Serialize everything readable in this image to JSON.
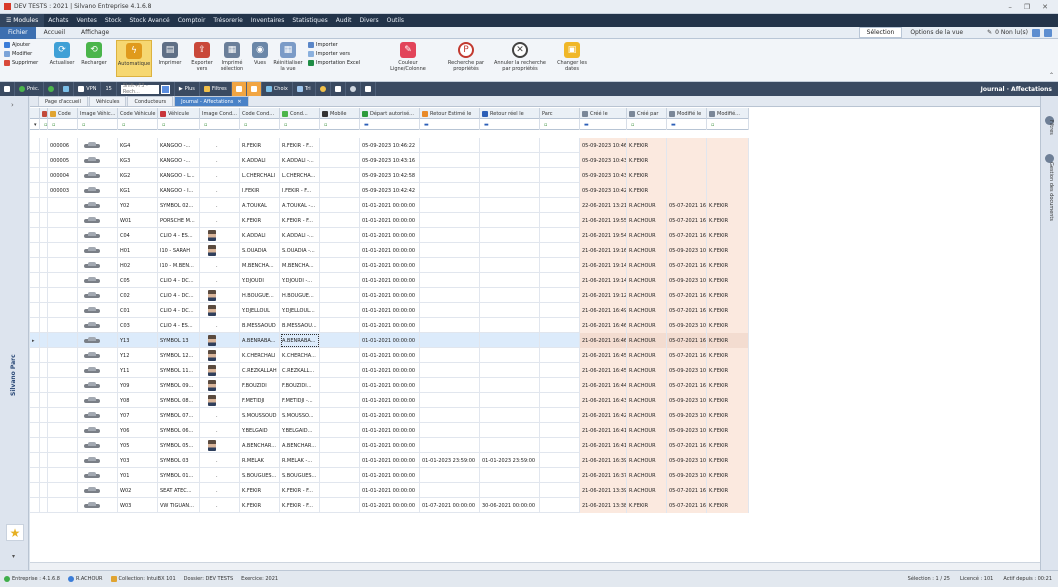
{
  "window": {
    "title": "DEV TESTS : 2021 | Silvano Entreprise 4.1.6.8",
    "controls": [
      "–",
      "❐",
      "✕"
    ]
  },
  "menu": {
    "modules": "Modules",
    "items": [
      "Achats",
      "Ventes",
      "Stock",
      "Stock Avancé",
      "Comptoir",
      "Trésorerie",
      "Inventaires",
      "Statistiques",
      "Audit",
      "Divers",
      "Outils"
    ]
  },
  "tabs": {
    "items": [
      "Fichier",
      "Accueil",
      "Affichage"
    ],
    "active": 0,
    "selection": "Sélection",
    "options": "Options de la vue",
    "nonlus": "0 Non lu(s)"
  },
  "ribbon": {
    "ajouter": "Ajouter",
    "modifier": "Modifier",
    "supprimer": "Supprimer",
    "actualiser": "Actualiser",
    "recharger": "Recharger",
    "automatique": "Automatique",
    "imprimer": "Imprimer",
    "exporter": "Exporter vers",
    "imprimer_sel": "Imprimé sélection",
    "vues": "Vues",
    "reinit": "Réinitialiser la vue",
    "importer": "Importer",
    "importer_vers": "Importer vers",
    "import_excel": "Importation Excel",
    "couleur": "Couleur Ligne/Colonne",
    "recherche_prop": "Recherche par propriétés",
    "annuler_rech": "Annuler la recherche par propriétés",
    "changer_dates": "Changer les dates"
  },
  "toolbar": {
    "prec": "Préc.",
    "vpn": "VPN",
    "count": "15",
    "search_placeholder": "Shift+F3 - Rech...",
    "plus": "Plus",
    "filtres": "Filtres",
    "choix": "Choix",
    "tri": "Tri",
    "breadcrumb": "Journal · Affectations"
  },
  "leftpanel": {
    "title": "Silvano Parc"
  },
  "rightpanel": {
    "filtres": "Filtres",
    "gestion": "Gestion des documents"
  },
  "doctabs": [
    {
      "label": "Page d'accueil"
    },
    {
      "label": "Véhicules"
    },
    {
      "label": "Conducteurs"
    },
    {
      "label": "Journal - Affectations",
      "active": true
    }
  ],
  "columns": [
    "Code",
    "Image Véhic...",
    "Code Véhicule",
    "Véhicule",
    "Image Cond...",
    "Code Cond...",
    "Cond...",
    "Mobile",
    "Départ autorisé...",
    "Retour Estimé le",
    "Retour réel le",
    "Parc",
    "Créé le",
    "Créé par",
    "Modifié le",
    "Modifié..."
  ],
  "rows": [
    {
      "code": "000006",
      "cv": "KG4",
      "veh": "KANGOO -...",
      "face": false,
      "cc": "R.FEKIR",
      "cond": "R.FEKIR - F...",
      "dep": "05-09-2023 10:46:22",
      "re": "",
      "rr": "",
      "cree": "05-09-2023 10:46:37",
      "cpar": "K.FEKIR",
      "mod": "",
      "mpar": ""
    },
    {
      "code": "000005",
      "cv": "KG3",
      "veh": "KANGOO -...",
      "face": false,
      "cc": "K.ADDALI",
      "cond": "K.ADDALI -...",
      "dep": "05-09-2023 10:43:16",
      "re": "",
      "rr": "",
      "cree": "05-09-2023 10:43:28",
      "cpar": "K.FEKIR",
      "mod": "",
      "mpar": ""
    },
    {
      "code": "000004",
      "cv": "KG2",
      "veh": "KANGOO - L...",
      "face": false,
      "cc": "L.CHERCHALI",
      "cond": "L.CHERCHA...",
      "dep": "05-09-2023 10:42:58",
      "re": "",
      "rr": "",
      "cree": "05-09-2023 10:43:10",
      "cpar": "K.FEKIR",
      "mod": "",
      "mpar": ""
    },
    {
      "code": "000003",
      "cv": "KG1",
      "veh": "KANGOO - I...",
      "face": false,
      "cc": "I.FEKIR",
      "cond": "I.FEKIR - F...",
      "dep": "05-09-2023 10:42:42",
      "re": "",
      "rr": "",
      "cree": "05-09-2023 10:42:53",
      "cpar": "K.FEKIR",
      "mod": "",
      "mpar": ""
    },
    {
      "code": "",
      "cv": "Y02",
      "veh": "SYMBOL 02...",
      "face": false,
      "cc": "A.TOUKAL",
      "cond": "A.TOUKAL -...",
      "dep": "01-01-2021 00:00:00",
      "re": "",
      "rr": "",
      "cree": "22-06-2021 13:21:27",
      "cpar": "R.ACHOUR",
      "mod": "05-07-2021 16:01:42",
      "mpar": "K.FEKIR"
    },
    {
      "code": "",
      "cv": "W01",
      "veh": "PORSCHE M...",
      "face": false,
      "cc": "K.FEKIR",
      "cond": "K.FEKIR - F...",
      "dep": "01-01-2021 00:00:00",
      "re": "",
      "rr": "",
      "cree": "21-06-2021 19:55:25",
      "cpar": "R.ACHOUR",
      "mod": "05-07-2021 16:01:42",
      "mpar": "K.FEKIR"
    },
    {
      "code": "",
      "cv": "C04",
      "veh": "CLIO 4 - ES...",
      "face": true,
      "cc": "K.ADDALI",
      "cond": "K.ADDALI -...",
      "dep": "01-01-2021 00:00:00",
      "re": "",
      "rr": "",
      "cree": "21-06-2021 19:54:40",
      "cpar": "R.ACHOUR",
      "mod": "05-07-2021 16:01:42",
      "mpar": "K.FEKIR"
    },
    {
      "code": "",
      "cv": "H01",
      "veh": "I10 - SARAH",
      "face": true,
      "cc": "S.OUADIA",
      "cond": "S.OUADIA -...",
      "dep": "01-01-2021 00:00:00",
      "re": "",
      "rr": "",
      "cree": "21-06-2021 19:16:25",
      "cpar": "R.ACHOUR",
      "mod": "05-09-2023 10:37:22",
      "mpar": "K.FEKIR"
    },
    {
      "code": "",
      "cv": "H02",
      "veh": "I10 - M.BEN...",
      "face": false,
      "cc": "M.BENCHA...",
      "cond": "M.BENCHA...",
      "dep": "01-01-2021 00:00:00",
      "re": "",
      "rr": "",
      "cree": "21-06-2021 19:14:53",
      "cpar": "R.ACHOUR",
      "mod": "05-07-2021 16:01:42",
      "mpar": "K.FEKIR"
    },
    {
      "code": "",
      "cv": "C05",
      "veh": "CLIO 4 - DC...",
      "face": false,
      "cc": "Y.DJOUDI",
      "cond": "Y.DJOUDI -...",
      "dep": "01-01-2021 00:00:00",
      "re": "",
      "rr": "",
      "cree": "21-06-2021 19:14:26",
      "cpar": "R.ACHOUR",
      "mod": "05-09-2023 10:24:27",
      "mpar": "K.FEKIR"
    },
    {
      "code": "",
      "cv": "C02",
      "veh": "CLIO 4 - DC...",
      "face": true,
      "cc": "H.BOUGUE...",
      "cond": "H.BOUGUE...",
      "dep": "01-01-2021 00:00:00",
      "re": "",
      "rr": "",
      "cree": "21-06-2021 19:12:37",
      "cpar": "R.ACHOUR",
      "mod": "05-07-2021 16:01:42",
      "mpar": "K.FEKIR"
    },
    {
      "code": "",
      "cv": "C01",
      "veh": "CLIO 4 - DC...",
      "face": true,
      "cc": "Y.DJELLOUL",
      "cond": "Y.DJELLOUL...",
      "dep": "01-01-2021 00:00:00",
      "re": "",
      "rr": "",
      "cree": "21-06-2021 16:49:34",
      "cpar": "R.ACHOUR",
      "mod": "05-07-2021 16:01:42",
      "mpar": "K.FEKIR"
    },
    {
      "code": "",
      "cv": "C03",
      "veh": "CLIO 4 - ES...",
      "face": false,
      "cc": "B.MESSAOUD",
      "cond": "B.MESSAOU...",
      "dep": "01-01-2021 00:00:00",
      "re": "",
      "rr": "",
      "cree": "21-06-2021 16:46:57",
      "cpar": "R.ACHOUR",
      "mod": "05-09-2023 10:28:52",
      "mpar": "K.FEKIR"
    },
    {
      "code": "",
      "cv": "Y13",
      "veh": "SYMBOL 13",
      "face": true,
      "cc": "A.BENRABA...",
      "cond": "A.BENRABA...",
      "dep": "01-01-2021 00:00:00",
      "re": "",
      "rr": "",
      "cree": "21-06-2021 16:46:21",
      "cpar": "R.ACHOUR",
      "mod": "05-07-2021 16:01:42",
      "mpar": "K.FEKIR",
      "sel": true
    },
    {
      "code": "",
      "cv": "Y12",
      "veh": "SYMBOL 12...",
      "face": true,
      "cc": "K.CHERCHALI",
      "cond": "K.CHERCHA...",
      "dep": "01-01-2021 00:00:00",
      "re": "",
      "rr": "",
      "cree": "21-06-2021 16:45:42",
      "cpar": "R.ACHOUR",
      "mod": "05-07-2021 16:01:42",
      "mpar": "K.FEKIR"
    },
    {
      "code": "",
      "cv": "Y11",
      "veh": "SYMBOL 11...",
      "face": true,
      "cc": "C.REZKALLAH",
      "cond": "C.REZKALL...",
      "dep": "01-01-2021 00:00:00",
      "re": "",
      "rr": "",
      "cree": "21-06-2021 16:45:16",
      "cpar": "R.ACHOUR",
      "mod": "05-09-2023 10:39:47",
      "mpar": "K.FEKIR"
    },
    {
      "code": "",
      "cv": "Y09",
      "veh": "SYMBOL 09...",
      "face": true,
      "cc": "F.BOUZIDI",
      "cond": "F.BOUZIDI...",
      "dep": "01-01-2021 00:00:00",
      "re": "",
      "rr": "",
      "cree": "21-06-2021 16:44:14",
      "cpar": "R.ACHOUR",
      "mod": "05-07-2021 16:01:42",
      "mpar": "K.FEKIR"
    },
    {
      "code": "",
      "cv": "Y08",
      "veh": "SYMBOL 08...",
      "face": true,
      "cc": "F.METIDJI",
      "cond": "F.METIDJI -...",
      "dep": "01-01-2021 00:00:00",
      "re": "",
      "rr": "",
      "cree": "21-06-2021 16:43:46",
      "cpar": "R.ACHOUR",
      "mod": "05-09-2023 10:41:44",
      "mpar": "K.FEKIR"
    },
    {
      "code": "",
      "cv": "Y07",
      "veh": "SYMBOL 07...",
      "face": false,
      "cc": "S.MOUSSOUD",
      "cond": "S.MOUSSO...",
      "dep": "01-01-2021 00:00:00",
      "re": "",
      "rr": "",
      "cree": "21-06-2021 16:42:04",
      "cpar": "R.ACHOUR",
      "mod": "05-09-2023 10:31:25",
      "mpar": "K.FEKIR"
    },
    {
      "code": "",
      "cv": "Y06",
      "veh": "SYMBOL 06...",
      "face": false,
      "cc": "Y.BELGAID",
      "cond": "Y.BELGAID...",
      "dep": "01-01-2021 00:00:00",
      "re": "",
      "rr": "",
      "cree": "21-06-2021 16:41:57",
      "cpar": "R.ACHOUR",
      "mod": "05-09-2023 10:41:13",
      "mpar": "K.FEKIR"
    },
    {
      "code": "",
      "cv": "Y05",
      "veh": "SYMBOL 05...",
      "face": true,
      "cc": "A.BENCHAR...",
      "cond": "A.BENCHAR...",
      "dep": "01-01-2021 00:00:00",
      "re": "",
      "rr": "",
      "cree": "21-06-2021 16:41:31",
      "cpar": "R.ACHOUR",
      "mod": "05-07-2021 16:01:42",
      "mpar": "K.FEKIR"
    },
    {
      "code": "",
      "cv": "Y03",
      "veh": "SYMBOL 03",
      "face": false,
      "cc": "R.MELAK",
      "cond": "R.MELAK -...",
      "dep": "01-01-2021 00:00:00",
      "re": "01-01-2023 23:59:00",
      "rr": "01-01-2023 23:59:00",
      "cree": "21-06-2021 16:39:35",
      "cpar": "R.ACHOUR",
      "mod": "05-09-2023 10:30:14",
      "mpar": "K.FEKIR"
    },
    {
      "code": "",
      "cv": "Y01",
      "veh": "SYMBOL 01...",
      "face": false,
      "cc": "S.BOUGUES...",
      "cond": "S.BOUGUES...",
      "dep": "01-01-2021 00:00:00",
      "re": "",
      "rr": "",
      "cree": "21-06-2021 16:37:06",
      "cpar": "R.ACHOUR",
      "mod": "05-09-2023 10:39:20",
      "mpar": "K.FEKIR"
    },
    {
      "code": "",
      "cv": "W02",
      "veh": "SEAT ATEC...",
      "face": false,
      "cc": "K.FEKIR",
      "cond": "K.FEKIR - F...",
      "dep": "01-01-2021 00:00:00",
      "re": "",
      "rr": "",
      "cree": "21-06-2021 13:39:59",
      "cpar": "R.ACHOUR",
      "mod": "05-07-2021 16:01:42",
      "mpar": "K.FEKIR"
    },
    {
      "code": "",
      "cv": "W03",
      "veh": "VW TIGUAN...",
      "face": false,
      "cc": "K.FEKIR",
      "cond": "K.FEKIR - F...",
      "dep": "01-01-2021 00:00:00",
      "re": "01-07-2021 00:00:00",
      "rr": "30-06-2021 00:00:00",
      "cree": "21-06-2021 13:38:17",
      "cpar": "K.FEKIR",
      "mod": "05-07-2021 16:01:42",
      "mpar": "K.FEKIR"
    }
  ],
  "status": {
    "version": "Entreprise : 4.1.6.8",
    "user": "R.ACHOUR",
    "collection": "Collection: IntuiBX 101",
    "dossier": "Dossier: DEV TESTS",
    "exercice": "Exercice: 2021",
    "selection": "Sélection : 1 / 25",
    "licence": "Licencé : 101",
    "actif": "Actif depuis : 00:21"
  },
  "colors": {
    "menubar": "#23344a",
    "accent": "#3c6fb0",
    "highlight": "#f1a543",
    "audit_cols": "#fbe9df"
  }
}
